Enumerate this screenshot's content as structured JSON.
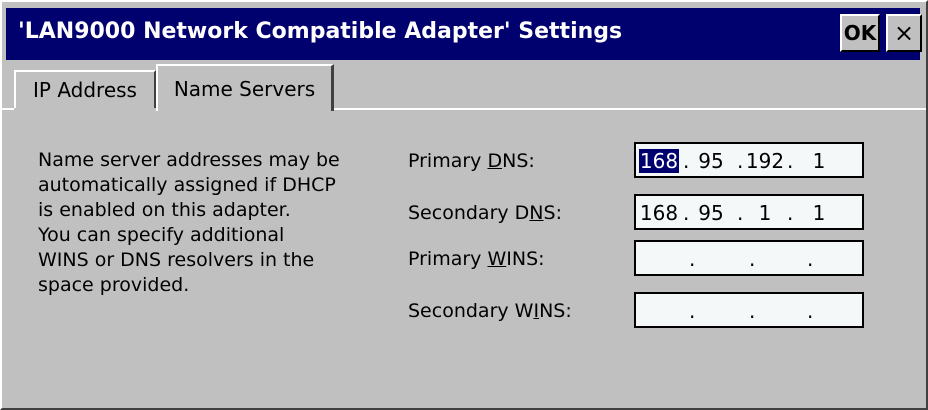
{
  "window": {
    "title": "'LAN9000 Network Compatible Adapter' Settings",
    "ok_label": "OK",
    "close_glyph": "×"
  },
  "tabs": [
    {
      "label": "IP Address",
      "active": false
    },
    {
      "label": "Name Servers",
      "active": true
    }
  ],
  "description": [
    "Name server addresses may be",
    "automatically assigned if DHCP",
    "is enabled on this adapter.",
    "You can specify additional",
    "WINS or DNS resolvers in the",
    "space provided."
  ],
  "fields": {
    "primary_dns": {
      "label_pre": "Primary ",
      "label_key": "D",
      "label_post": "NS:",
      "octets": [
        "168",
        "95",
        "192",
        "1"
      ],
      "selected_octet": 0
    },
    "secondary_dns": {
      "label_pre": "Secondary D",
      "label_key": "N",
      "label_post": "S:",
      "octets": [
        "168",
        "95",
        "1",
        "1"
      ]
    },
    "primary_wins": {
      "label_pre": "Primary ",
      "label_key": "W",
      "label_post": "INS:",
      "octets": [
        "",
        "",
        "",
        ""
      ]
    },
    "secondary_wins": {
      "label_pre": "Secondary W",
      "label_key": "I",
      "label_post": "NS:",
      "octets": [
        "",
        "",
        "",
        ""
      ]
    }
  },
  "colors": {
    "titlebar": "#00006e",
    "face": "#c0c0c0",
    "field_bg": "#f4f8f8",
    "selection": "#00006e"
  }
}
